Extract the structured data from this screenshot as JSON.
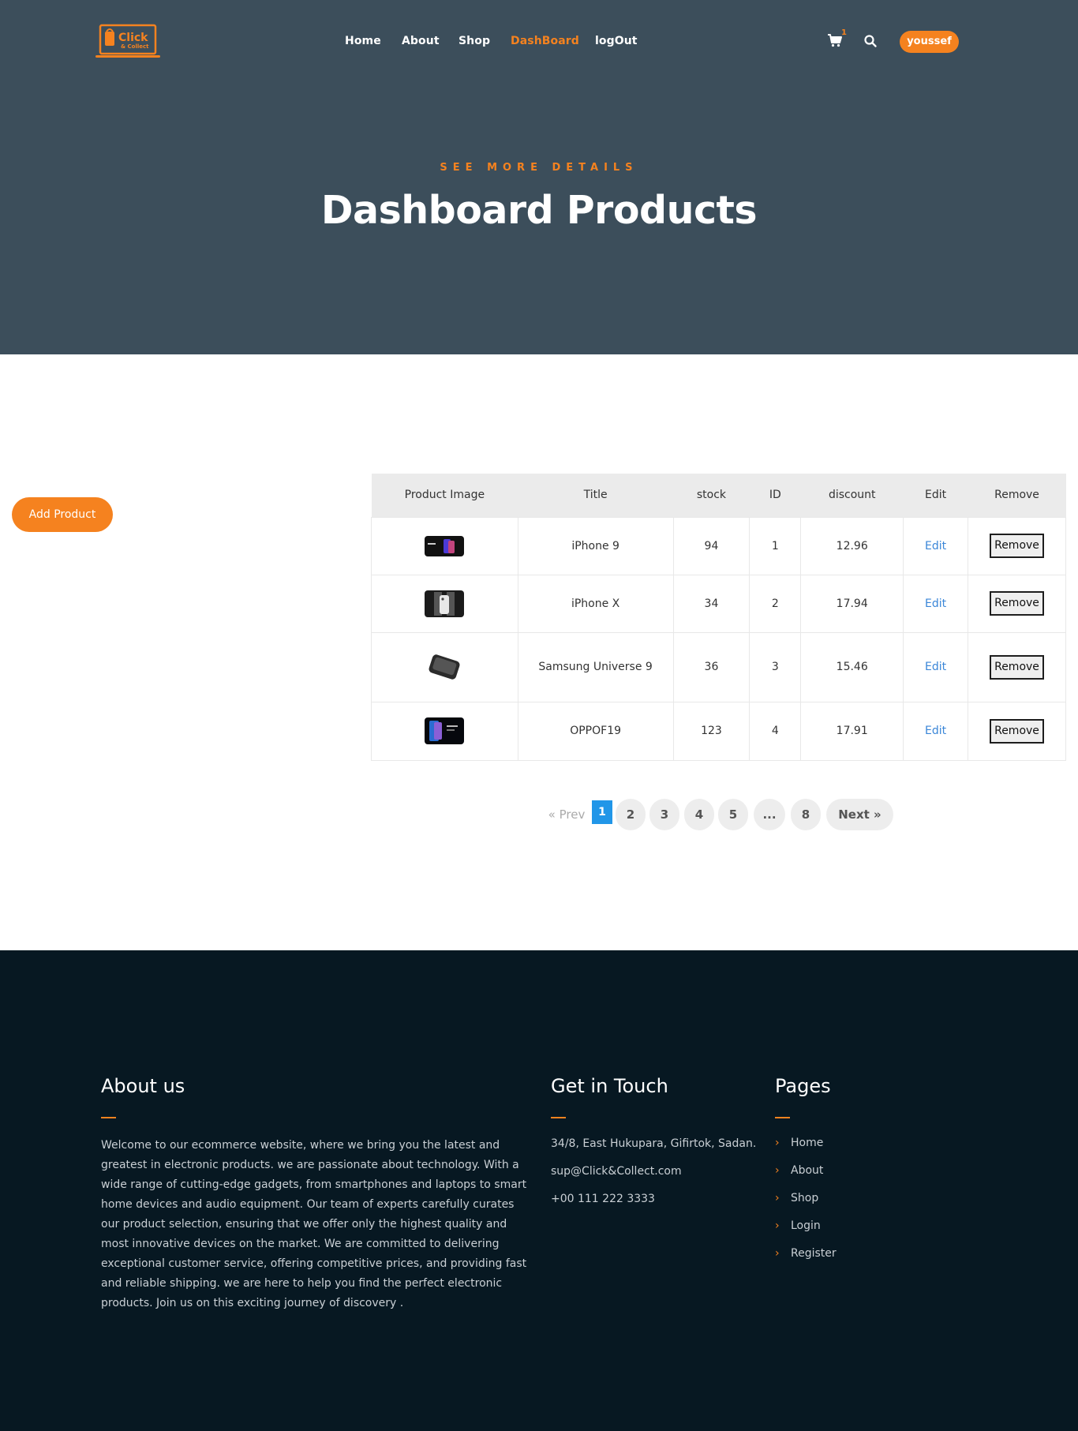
{
  "brand": {
    "logo_text": "Click",
    "logo_sub": "& Collect",
    "accent": "#f5821f",
    "hero_bg": "#3c4e5b",
    "footer_bg": "#071822"
  },
  "nav": {
    "items": [
      {
        "label": "Home",
        "active": false
      },
      {
        "label": "About",
        "active": false
      },
      {
        "label": "Shop",
        "active": false
      },
      {
        "label": "DashBoard",
        "active": true
      },
      {
        "label": "logOut",
        "active": false
      }
    ],
    "cart_count": "1",
    "cart_icon": "cart-icon",
    "search_icon": "search-icon",
    "user": "youssef"
  },
  "hero": {
    "eyebrow": "SEE MORE DETAILS",
    "title": "Dashboard Products"
  },
  "main": {
    "add_label": "Add Product",
    "table": {
      "headers": [
        "Product Image",
        "Title",
        "stock",
        "ID",
        "discount",
        "Edit",
        "Remove"
      ],
      "rows": [
        {
          "title": "iPhone 9",
          "stock": "94",
          "id": "1",
          "discount": "12.96",
          "edit": "Edit",
          "remove": "Remove"
        },
        {
          "title": "iPhone X",
          "stock": "34",
          "id": "2",
          "discount": "17.94",
          "edit": "Edit",
          "remove": "Remove"
        },
        {
          "title": "Samsung Universe 9",
          "stock": "36",
          "id": "3",
          "discount": "15.46",
          "edit": "Edit",
          "remove": "Remove"
        },
        {
          "title": "OPPOF19",
          "stock": "123",
          "id": "4",
          "discount": "17.91",
          "edit": "Edit",
          "remove": "Remove"
        }
      ]
    },
    "pagination": {
      "prev": "«  Prev",
      "pages": [
        "1",
        "2",
        "3",
        "4",
        "5",
        "...",
        "8"
      ],
      "current": "1",
      "next": "Next  »"
    }
  },
  "footer": {
    "about": {
      "heading": "About us",
      "text": "Welcome to our ecommerce website, where we bring you the latest and greatest in electronic products. we are passionate about technology. With a wide range of cutting-edge gadgets, from smartphones and laptops to smart home devices and audio equipment. Our team of experts carefully curates our product selection, ensuring that we offer only the highest quality and most innovative devices on the market. We are committed to delivering exceptional customer service, offering competitive prices, and providing fast and reliable shipping. we are here to help you find the perfect electronic products. Join us on this exciting journey of discovery ."
    },
    "contact": {
      "heading": "Get in Touch",
      "address": "34/8, East Hukupara, Gifirtok, Sadan.",
      "email": "sup@Click&Collect.com",
      "phone": "+00 111 222 3333"
    },
    "pages": {
      "heading": "Pages",
      "links": [
        "Home",
        "About",
        "Shop",
        "Login",
        "Register"
      ]
    }
  }
}
